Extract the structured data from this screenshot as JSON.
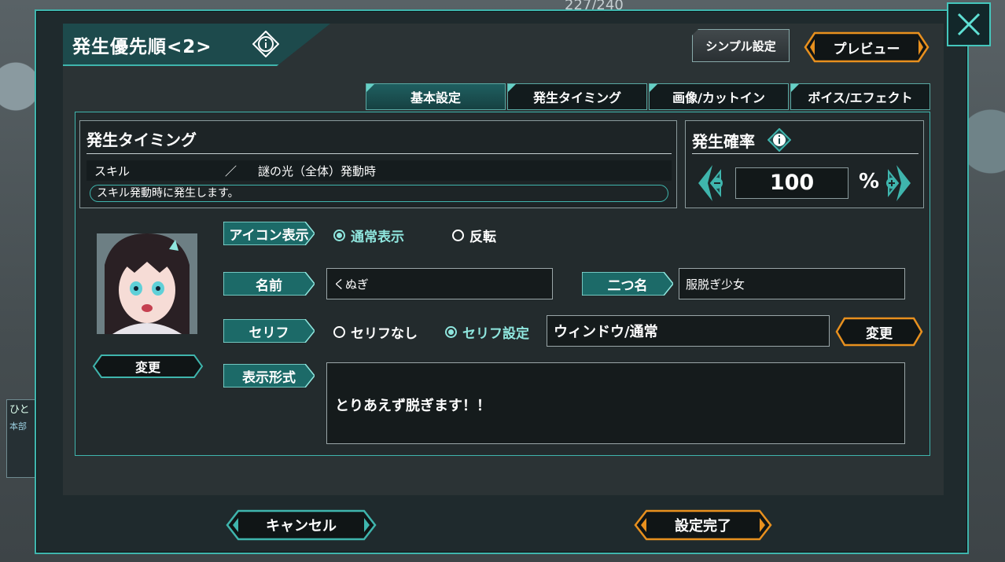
{
  "background": {
    "count_text": "227/240",
    "left_label": "ひと",
    "left_sublabel": "本部"
  },
  "header": {
    "title": "発生優先順<2>",
    "info_icon": "info-diamond-icon",
    "simple_settings_label": "シンプル設定",
    "preview_label": "プレビュー",
    "close_icon": "close-x-icon"
  },
  "tabs": [
    {
      "label": "基本設定",
      "active": true
    },
    {
      "label": "発生タイミング",
      "active": false
    },
    {
      "label": "画像/カットイン",
      "active": false
    },
    {
      "label": "ボイス/エフェクト",
      "active": false
    }
  ],
  "timing": {
    "title": "発生タイミング",
    "type": "スキル",
    "separator": "／",
    "condition": "謎の光（全体）発動時",
    "description": "スキル発動時に発生します。"
  },
  "probability": {
    "title": "発生確率",
    "value": "100",
    "unit": "%",
    "decrease_icon": "minus-arrow-icon",
    "increase_icon": "plus-arrow-icon"
  },
  "character": {
    "change_portrait_label": "変更",
    "icon_display_label": "アイコン表示",
    "icon_display_options": [
      {
        "label": "通常表示",
        "selected": true
      },
      {
        "label": "反転",
        "selected": false
      }
    ],
    "name_label": "名前",
    "name_value": "くぬぎ",
    "alias_label": "二つ名",
    "alias_value": "服脱ぎ少女",
    "dialogue_label": "セリフ",
    "dialogue_options": [
      {
        "label": "セリフなし",
        "selected": false
      },
      {
        "label": "セリフ設定",
        "selected": true
      }
    ],
    "window_style": "ウィンドウ/通常",
    "window_change_label": "変更",
    "display_format_label": "表示形式",
    "dialogue_text": "とりあえず脱ぎます！！"
  },
  "footer": {
    "cancel_label": "キャンセル",
    "confirm_label": "設定完了"
  },
  "colors": {
    "accent_teal": "#3fb5ad",
    "accent_orange": "#e8901e",
    "panel_dark": "#1d2426"
  }
}
